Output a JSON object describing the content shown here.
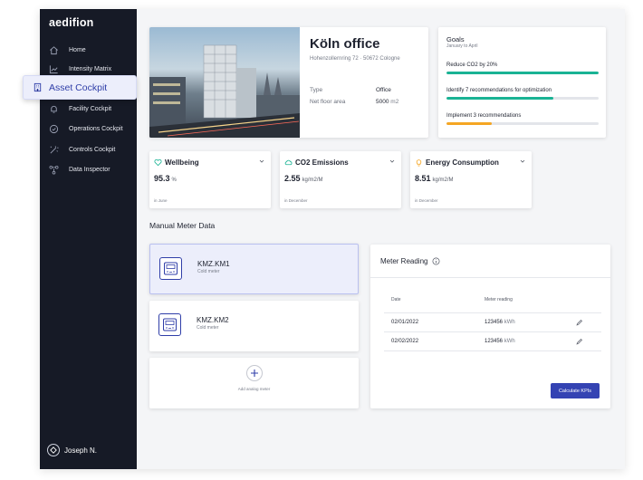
{
  "app": {
    "logo": "aedifion"
  },
  "sidebar": {
    "items": [
      {
        "label": "Home",
        "icon": "home-icon"
      },
      {
        "label": "Intensity Matrix",
        "icon": "chart-icon"
      },
      {
        "label": "Asset Cockpit",
        "icon": "building-icon",
        "active": true
      },
      {
        "label": "Facility Cockpit",
        "icon": "bell-icon"
      },
      {
        "label": "Operations Cockpit",
        "icon": "check-circle-icon"
      },
      {
        "label": "Controls Cockpit",
        "icon": "wand-icon"
      },
      {
        "label": "Data Inspector",
        "icon": "nodes-icon"
      }
    ],
    "user": "Joseph N."
  },
  "office": {
    "title": "Köln office",
    "address": "Hohenzollernring 72 · 50672 Cologne",
    "type_label": "Type",
    "type_value": "Office",
    "area_label": "Net floor area",
    "area_value": "5000",
    "area_unit": "m2"
  },
  "goals": {
    "title": "Goals",
    "subtitle": "January to April",
    "items": [
      {
        "label": "Reduce CO2 by 20%",
        "progress": 1.0,
        "color": "#1ab394"
      },
      {
        "label": "Identify 7 recommendations for optimization",
        "progress": 0.7,
        "color": "#1ab394"
      },
      {
        "label": "Implement 3 recommendations",
        "progress": 0.3,
        "color": "#f5a623"
      }
    ]
  },
  "kpis": [
    {
      "title": "Wellbeing",
      "value": "95.3",
      "unit": "%",
      "footer": "in June",
      "icon": "heart-icon",
      "color": "#1ab394"
    },
    {
      "title": "CO2 Emissions",
      "value": "2.55",
      "unit": "kg/m2/M",
      "footer": "in December",
      "icon": "cloud-icon",
      "color": "#1ab394"
    },
    {
      "title": "Energy Consumption",
      "value": "8.51",
      "unit": "kg/m2/M",
      "footer": "in December",
      "icon": "bulb-icon",
      "color": "#f5a623"
    }
  ],
  "manual_meter": {
    "section_title": "Manual Meter Data",
    "meters": [
      {
        "name": "KMZ.KM1",
        "type": "Cold meter"
      },
      {
        "name": "KMZ.KM2",
        "type": "Cold meter"
      }
    ],
    "add_label": "Add analog meter"
  },
  "reading": {
    "title": "Meter Reading",
    "col_date": "Date",
    "col_reading": "Meter reading",
    "rows": [
      {
        "date": "02/01/2022",
        "value": "123456",
        "unit": "kWh"
      },
      {
        "date": "02/02/2022",
        "value": "123456",
        "unit": "kWh"
      }
    ],
    "button": "Calculate KPIs"
  },
  "colors": {
    "sidebar": "#161a26",
    "accent": "#3443b3",
    "green": "#1ab394",
    "orange": "#f5a623"
  }
}
